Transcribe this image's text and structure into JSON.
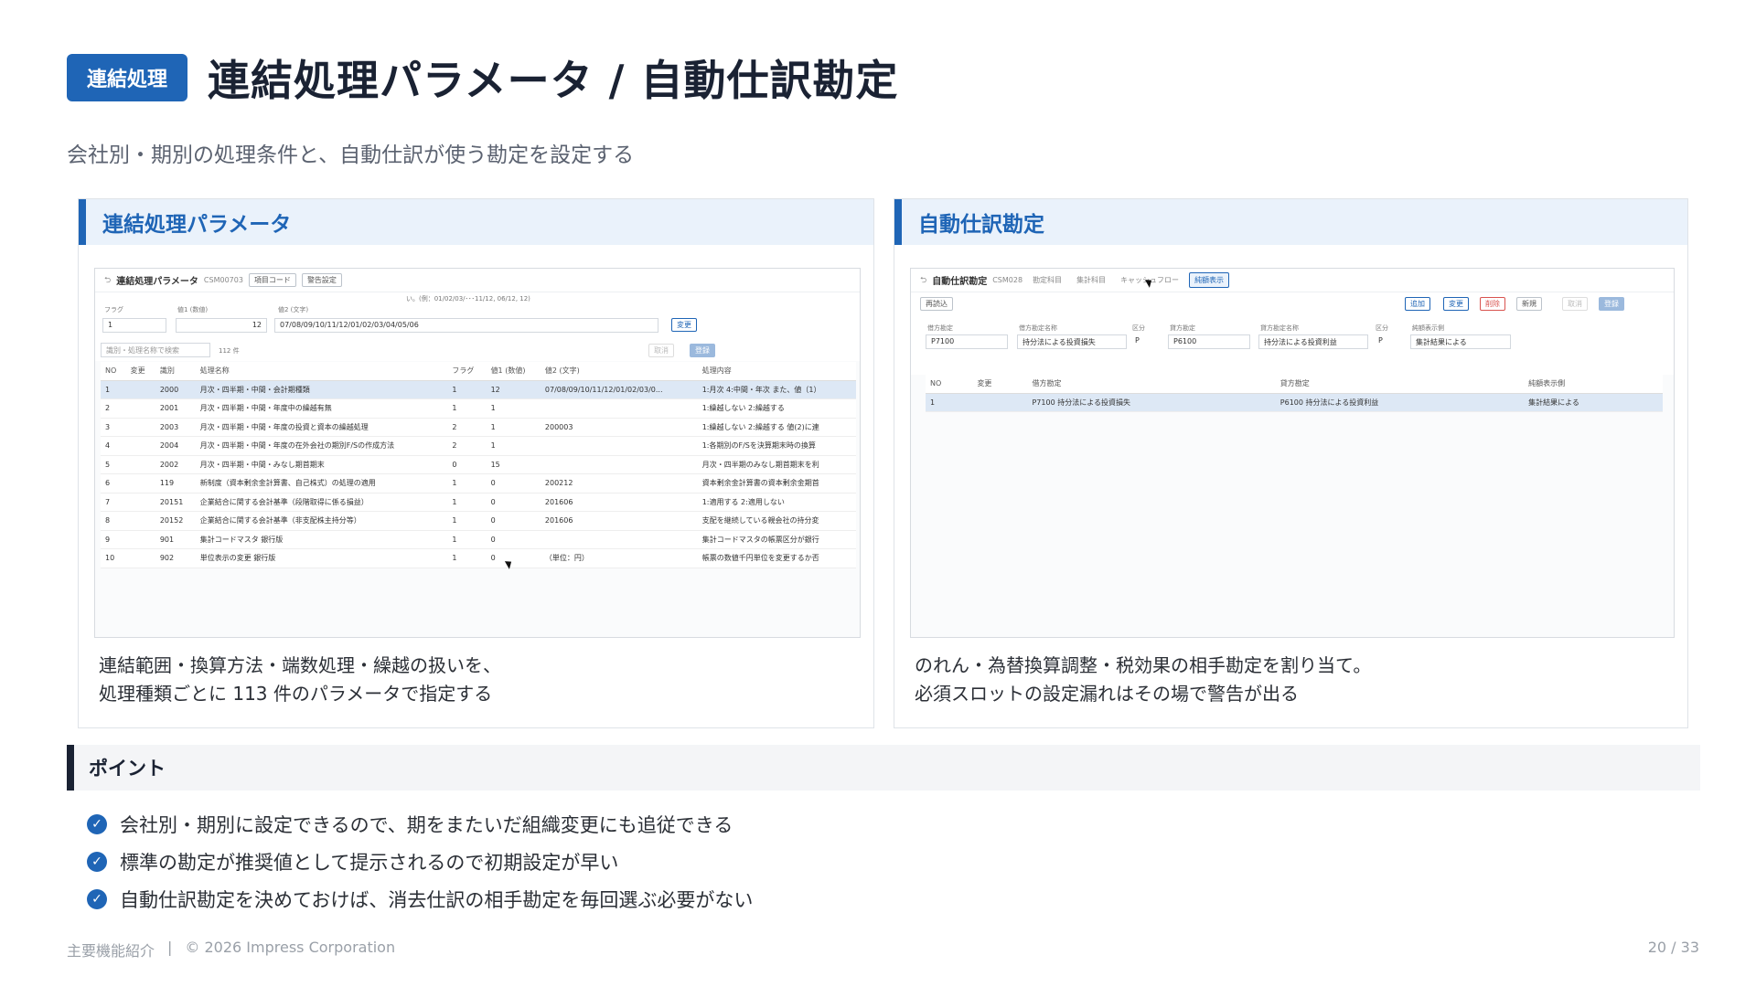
{
  "header": {
    "badge": "連結処理",
    "title": "連結処理パラメータ / 自動仕訳勘定"
  },
  "subtitle": "会社別・期別の処理条件と、自動仕訳が使う勘定を設定する",
  "left_panel": {
    "heading": "連結処理パラメータ",
    "desc_line1": "連結範囲・換算方法・端数処理・繰越の扱いを、",
    "desc_line2": "処理種類ごとに 113 件のパラメータで指定する",
    "screen": {
      "title": "連結処理パラメータ",
      "code": "CSM00703",
      "btn_item_code": "項目コード",
      "btn_warning": "警告設定",
      "hint": "い。(例：01/02/03/･･･11/12, 06/12, 12)",
      "label_flag": "フラグ",
      "label_v1": "値1 (数値)",
      "label_v2": "値2 (文字)",
      "field_flag": "1",
      "field_v1": "12",
      "field_v2": "07/08/09/10/11/12/01/02/03/04/05/06",
      "btn_change": "変更",
      "search_placeholder": "識別・処理名称で検索",
      "count": "112 件",
      "btn_cancel": "取消",
      "btn_register": "登録",
      "columns": [
        "NO",
        "変更",
        "識別",
        "処理名称",
        "フラグ",
        "値1 (数値)",
        "値2 (文字)",
        "処理内容"
      ],
      "rows": [
        [
          "1",
          "",
          "2000",
          "月次・四半期・中間・会計期種類",
          "1",
          "12",
          "07/08/09/10/11/12/01/02/03/0...",
          "1:月次 4:中間・年次 また、値（1）"
        ],
        [
          "2",
          "",
          "2001",
          "月次・四半期・中間・年度中の繰越有無",
          "1",
          "1",
          "",
          "1:繰越しない 2:繰越する"
        ],
        [
          "3",
          "",
          "2003",
          "月次・四半期・中間・年度の投資と資本の繰越処理",
          "2",
          "1",
          "200003",
          "1:繰越しない 2:繰越する 値(2)に連"
        ],
        [
          "4",
          "",
          "2004",
          "月次・四半期・中間・年度の在外会社の期別F/Sの作成方法",
          "2",
          "1",
          "",
          "1:各期別のF/Sを決算期末時の換算"
        ],
        [
          "5",
          "",
          "2002",
          "月次・四半期・中間・みなし期首期末",
          "0",
          "15",
          "",
          "月次・四半期のみなし期首期末を利"
        ],
        [
          "6",
          "",
          "119",
          "新制度（資本剰余金計算書、自己株式）の処理の適用",
          "1",
          "0",
          "200212",
          "資本剰余金計算書の資本剰余金期首"
        ],
        [
          "7",
          "",
          "20151",
          "企業結合に関する会計基準（段階取得に係る損益）",
          "1",
          "0",
          "201606",
          "1:適用する 2:適用しない"
        ],
        [
          "8",
          "",
          "20152",
          "企業結合に関する会計基準（非支配株主持分等）",
          "1",
          "0",
          "201606",
          "支配を継続している親会社の持分変"
        ],
        [
          "9",
          "",
          "901",
          "集計コードマスタ 銀行版",
          "1",
          "0",
          "",
          "集計コードマスタの帳票区分が銀行"
        ],
        [
          "10",
          "",
          "902",
          "単位表示の変更 銀行版",
          "1",
          "0",
          "（単位：円）",
          "帳票の数値千円単位を変更するか否"
        ]
      ]
    }
  },
  "right_panel": {
    "heading": "自動仕訳勘定",
    "desc_line1": "のれん・為替換算調整・税効果の相手勘定を割り当て。",
    "desc_line2": "必須スロットの設定漏れはその場で警告が出る",
    "screen": {
      "title": "自動仕訳勘定",
      "code": "CSM028",
      "tabs": [
        "勘定科目",
        "集計科目",
        "キャッシュフロー",
        "純額表示"
      ],
      "btn_reload": "再読込",
      "btn_add": "追加",
      "btn_change": "変更",
      "btn_delete": "削除",
      "btn_new": "新規",
      "btn_cancel": "取消",
      "btn_register": "登録",
      "labels": [
        "借方勘定",
        "借方勘定名称",
        "区分",
        "貸方勘定",
        "貸方勘定名称",
        "区分",
        "純額表示側"
      ],
      "fields": [
        "P7100",
        "持分法による投資損失",
        "P",
        "P6100",
        "持分法による投資利益",
        "P",
        "集計結果による"
      ],
      "columns": [
        "NO",
        "変更",
        "借方勘定",
        "貸方勘定",
        "純額表示側"
      ],
      "rows": [
        [
          "1",
          "",
          "P7100 持分法による投資損失",
          "P6100 持分法による投資利益",
          "集計結果による"
        ]
      ]
    }
  },
  "point": {
    "heading": "ポイント",
    "items": [
      "会社別・期別に設定できるので、期をまたいだ組織変更にも追従できる",
      "標準の勘定が推奨値として提示されるので初期設定が早い",
      "自動仕訳勘定を決めておけば、消去仕訳の相手勘定を毎回選ぶ必要がない"
    ]
  },
  "footer": {
    "section": "主要機能紹介",
    "separator": "|",
    "copyright": "© 2026 Impress Corporation",
    "page": "20 / 33"
  },
  "colors": {
    "accent": "#1f65b6",
    "heading_bg": "#eaf2fb",
    "title": "#1a2233"
  },
  "icons": {
    "check": "check-circle-icon",
    "back": "back-arrow-icon",
    "cursor": "mouse-pointer-icon"
  }
}
